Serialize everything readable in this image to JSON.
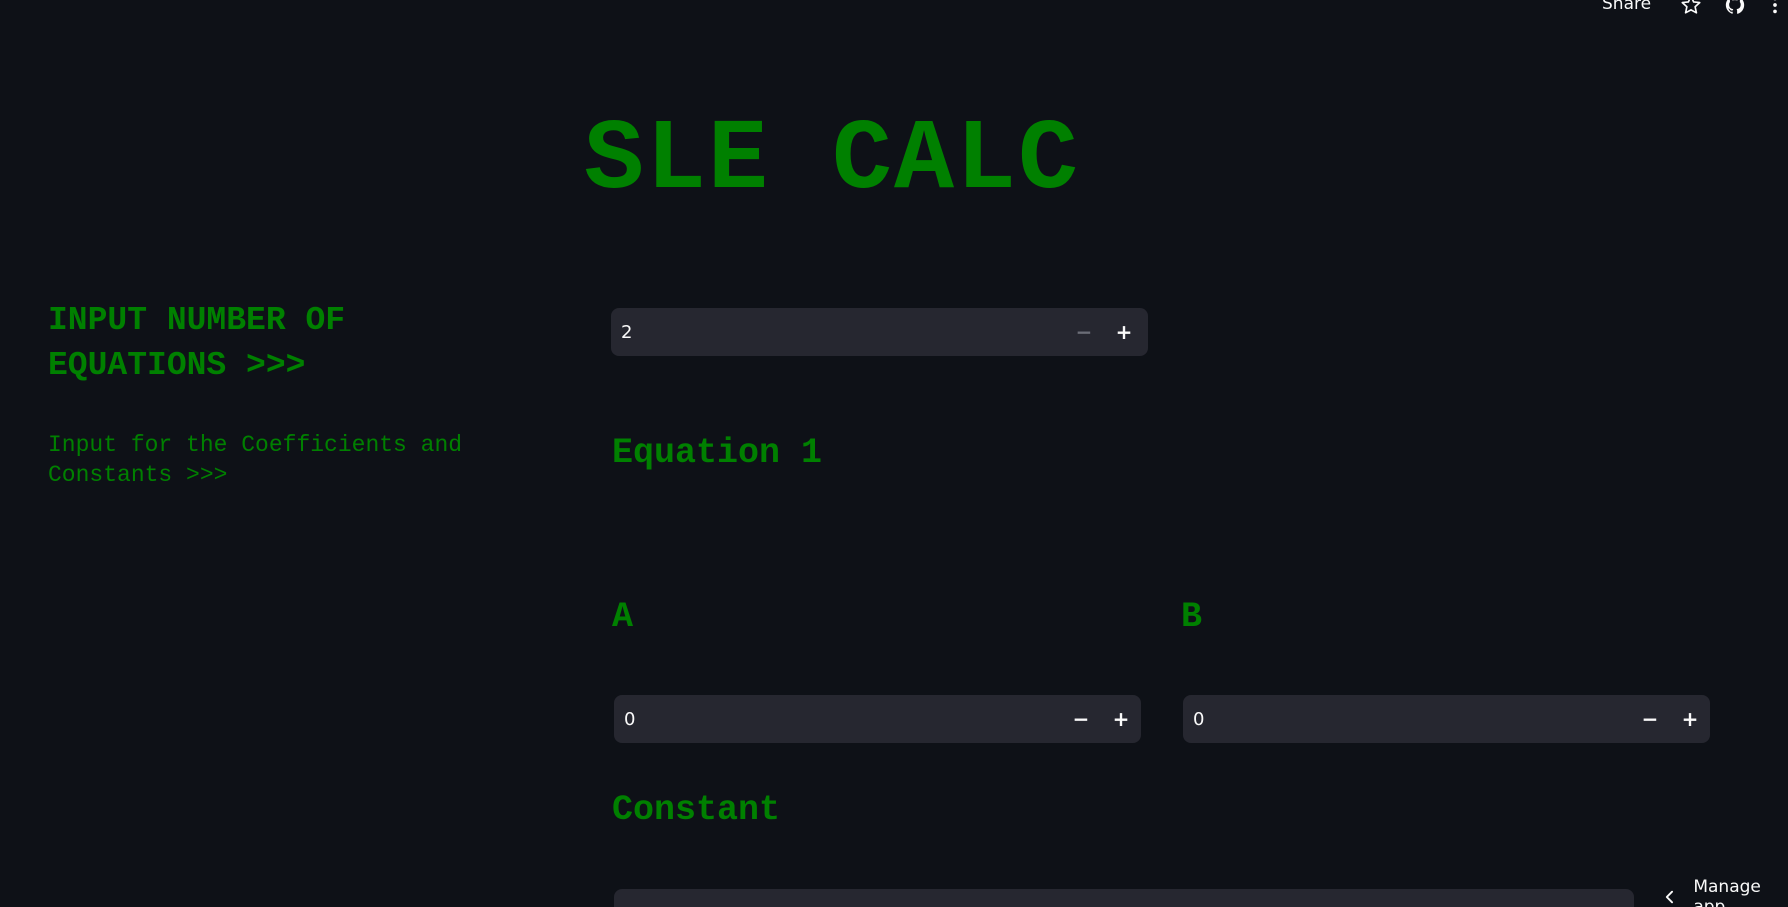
{
  "toolbar": {
    "share_label": "Share",
    "icons": [
      "star-icon",
      "github-icon",
      "more-vert-icon"
    ]
  },
  "title": "SLE CALC",
  "left": {
    "heading": "INPUT NUMBER OF EQUATIONS >>>",
    "subheading": "Input for the Coefficients and Constants >>>"
  },
  "num_equations": {
    "value": "2",
    "minus": "−",
    "plus": "+"
  },
  "equation": {
    "heading": "Equation 1",
    "coefficients": [
      {
        "label": "A",
        "value": "0",
        "minus": "−",
        "plus": "+"
      },
      {
        "label": "B",
        "value": "0",
        "minus": "−",
        "plus": "+"
      }
    ],
    "constant_label": "Constant"
  },
  "footer": {
    "manage_app_label": "Manage app"
  },
  "colors": {
    "background": "#0e1117",
    "accent_green": "#008000",
    "input_bg": "#262730"
  }
}
